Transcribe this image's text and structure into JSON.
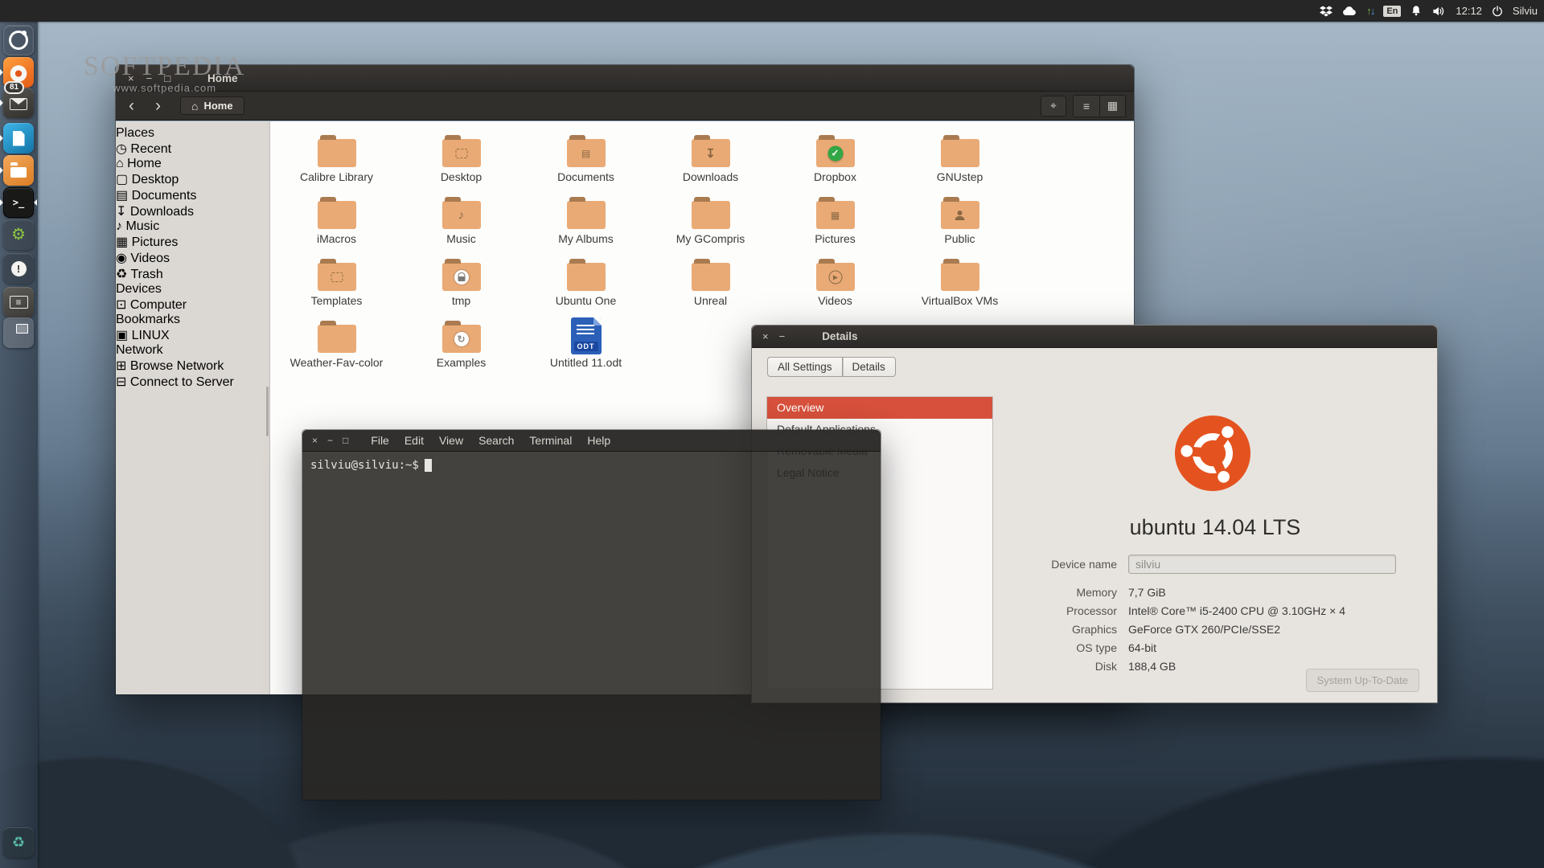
{
  "wm": {
    "close": "×",
    "min": "−",
    "max": "□"
  },
  "panel": {
    "time": "12:12",
    "user": "Silviu",
    "keyboard_layout": "En",
    "upload_glyph": "↑",
    "download_glyph": "↓"
  },
  "watermark": {
    "title": "SOFTPEDIA",
    "url": "www.softpedia.com"
  },
  "dock": {
    "items": [
      {
        "name": "dash-home-icon",
        "cls": "dash"
      },
      {
        "name": "firefox-icon",
        "cls": "firefox running"
      },
      {
        "name": "mail-icon",
        "cls": "mail running",
        "badge": "81"
      },
      {
        "name": "libreoffice-icon",
        "cls": "libre running"
      },
      {
        "name": "files-icon",
        "cls": "files running"
      },
      {
        "name": "terminal-icon",
        "cls": "terminal running focused"
      },
      {
        "name": "settings-gear-icon",
        "cls": "gear"
      },
      {
        "name": "update-alert-icon",
        "cls": "alert"
      },
      {
        "name": "tweaks-sliders-icon",
        "cls": "sliders"
      },
      {
        "name": "workspace-icon",
        "cls": "workspace"
      },
      {
        "name": "trash-icon",
        "cls": "trash"
      }
    ]
  },
  "file_manager": {
    "title": "Home",
    "breadcrumb": "Home",
    "home_glyph": "⌂",
    "back_glyph": "‹",
    "forward_glyph": "›",
    "location_glyph": "⌖",
    "list_view_glyph": "≡",
    "grid_view_glyph": "▦",
    "sidebar": [
      {
        "cls": "header",
        "label": "Places"
      },
      {
        "cls": "row",
        "icon": "recent-clock-icon",
        "glyph": "◷",
        "label": "Recent"
      },
      {
        "cls": "row selected",
        "icon": "home-icon",
        "glyph": "⌂",
        "label": "Home"
      },
      {
        "cls": "row",
        "icon": "desktop-icon",
        "glyph": "▢",
        "label": "Desktop"
      },
      {
        "cls": "row",
        "icon": "documents-icon",
        "glyph": "▤",
        "label": "Documents"
      },
      {
        "cls": "row",
        "icon": "downloads-icon",
        "glyph": "↧",
        "label": "Downloads"
      },
      {
        "cls": "row",
        "icon": "music-icon",
        "glyph": "♪",
        "label": "Music"
      },
      {
        "cls": "row",
        "icon": "pictures-icon",
        "glyph": "▦",
        "label": "Pictures"
      },
      {
        "cls": "row",
        "icon": "videos-icon",
        "glyph": "◉",
        "label": "Videos"
      },
      {
        "cls": "row",
        "icon": "trash-icon",
        "glyph": "♻",
        "label": "Trash"
      },
      {
        "cls": "header",
        "label": "Devices"
      },
      {
        "cls": "row",
        "icon": "computer-icon",
        "glyph": "⊡",
        "label": "Computer"
      },
      {
        "cls": "header",
        "label": "Bookmarks"
      },
      {
        "cls": "row",
        "icon": "bookmark-folder-icon",
        "glyph": "▣",
        "label": "LINUX"
      },
      {
        "cls": "header",
        "label": "Network"
      },
      {
        "cls": "row",
        "icon": "browse-network-icon",
        "glyph": "⊞",
        "label": "Browse Network"
      },
      {
        "cls": "row",
        "icon": "connect-server-icon",
        "glyph": "⊟",
        "label": "Connect to Server"
      }
    ],
    "grid": [
      {
        "label": "Calibre Library",
        "cls": "folder",
        "emblem": "em-none"
      },
      {
        "label": "Desktop",
        "cls": "folder",
        "emblem": "em-desktop"
      },
      {
        "label": "Documents",
        "cls": "folder",
        "emblem": "em-document"
      },
      {
        "label": "Downloads",
        "cls": "folder",
        "emblem": "em-download"
      },
      {
        "label": "Dropbox",
        "cls": "folder",
        "emblem": "em-check"
      },
      {
        "label": "GNUstep",
        "cls": "folder",
        "emblem": "em-none"
      },
      {
        "label": "iMacros",
        "cls": "folder",
        "emblem": "em-none"
      },
      {
        "label": "Music",
        "cls": "folder",
        "emblem": "em-music"
      },
      {
        "label": "My Albums",
        "cls": "folder",
        "emblem": "em-none"
      },
      {
        "label": "My GCompris",
        "cls": "folder",
        "emblem": "em-none"
      },
      {
        "label": "Pictures",
        "cls": "folder",
        "emblem": "em-photo"
      },
      {
        "label": "Public",
        "cls": "folder",
        "emblem": "em-people"
      },
      {
        "label": "Templates",
        "cls": "folder",
        "emblem": "em-template"
      },
      {
        "label": "tmp",
        "cls": "folder",
        "emblem": "em-lock"
      },
      {
        "label": "Ubuntu One",
        "cls": "folder",
        "emblem": "em-none"
      },
      {
        "label": "Unreal",
        "cls": "folder",
        "emblem": "em-none"
      },
      {
        "label": "Videos",
        "cls": "folder",
        "emblem": "em-play"
      },
      {
        "label": "VirtualBox VMs",
        "cls": "folder",
        "emblem": "em-none"
      },
      {
        "label": "Weather-Fav-color",
        "cls": "folder",
        "emblem": "em-none"
      },
      {
        "label": "Examples",
        "cls": "folder",
        "emblem": "em-link"
      },
      {
        "label": "Untitled 11.odt",
        "cls": "odt",
        "emblem": "em-none",
        "chip": "ODT"
      }
    ]
  },
  "terminal": {
    "menu": [
      "File",
      "Edit",
      "View",
      "Search",
      "Terminal",
      "Help"
    ],
    "prompt": "silviu@silviu:~$"
  },
  "details": {
    "title": "Details",
    "tabs": [
      "All Settings",
      "Details"
    ],
    "nav": [
      {
        "label": "Overview",
        "cls": "selected"
      },
      {
        "label": "Default Applications"
      },
      {
        "label": "Removable Media"
      },
      {
        "label": "Legal Notice"
      }
    ],
    "os_name": "ubuntu 14.04 LTS",
    "device_label": "Device name",
    "device_value": "silviu",
    "fields": [
      {
        "label": "Memory",
        "value": "7,7 GiB"
      },
      {
        "label": "Processor",
        "value": "Intel® Core™ i5-2400 CPU @ 3.10GHz × 4"
      },
      {
        "label": "Graphics",
        "value": "GeForce GTX 260/PCIe/SSE2"
      },
      {
        "label": "OS type",
        "value": "64-bit"
      },
      {
        "label": "Disk",
        "value": "188,4 GB"
      }
    ],
    "update_button": "System Up-To-Date"
  }
}
